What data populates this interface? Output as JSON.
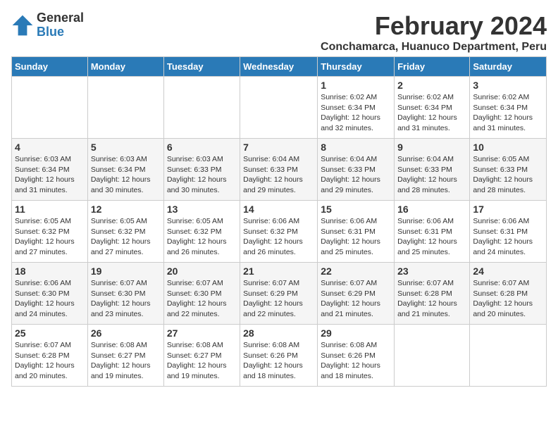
{
  "app": {
    "logo_general": "General",
    "logo_blue": "Blue",
    "title": "February 2024",
    "subtitle": "Conchamarca, Huanuco Department, Peru"
  },
  "header": {
    "days": [
      "Sunday",
      "Monday",
      "Tuesday",
      "Wednesday",
      "Thursday",
      "Friday",
      "Saturday"
    ]
  },
  "weeks": [
    {
      "cells": [
        {
          "day": "",
          "info": ""
        },
        {
          "day": "",
          "info": ""
        },
        {
          "day": "",
          "info": ""
        },
        {
          "day": "",
          "info": ""
        },
        {
          "day": "1",
          "info": "Sunrise: 6:02 AM\nSunset: 6:34 PM\nDaylight: 12 hours\nand 32 minutes."
        },
        {
          "day": "2",
          "info": "Sunrise: 6:02 AM\nSunset: 6:34 PM\nDaylight: 12 hours\nand 31 minutes."
        },
        {
          "day": "3",
          "info": "Sunrise: 6:02 AM\nSunset: 6:34 PM\nDaylight: 12 hours\nand 31 minutes."
        }
      ]
    },
    {
      "cells": [
        {
          "day": "4",
          "info": "Sunrise: 6:03 AM\nSunset: 6:34 PM\nDaylight: 12 hours\nand 31 minutes."
        },
        {
          "day": "5",
          "info": "Sunrise: 6:03 AM\nSunset: 6:34 PM\nDaylight: 12 hours\nand 30 minutes."
        },
        {
          "day": "6",
          "info": "Sunrise: 6:03 AM\nSunset: 6:33 PM\nDaylight: 12 hours\nand 30 minutes."
        },
        {
          "day": "7",
          "info": "Sunrise: 6:04 AM\nSunset: 6:33 PM\nDaylight: 12 hours\nand 29 minutes."
        },
        {
          "day": "8",
          "info": "Sunrise: 6:04 AM\nSunset: 6:33 PM\nDaylight: 12 hours\nand 29 minutes."
        },
        {
          "day": "9",
          "info": "Sunrise: 6:04 AM\nSunset: 6:33 PM\nDaylight: 12 hours\nand 28 minutes."
        },
        {
          "day": "10",
          "info": "Sunrise: 6:05 AM\nSunset: 6:33 PM\nDaylight: 12 hours\nand 28 minutes."
        }
      ]
    },
    {
      "cells": [
        {
          "day": "11",
          "info": "Sunrise: 6:05 AM\nSunset: 6:32 PM\nDaylight: 12 hours\nand 27 minutes."
        },
        {
          "day": "12",
          "info": "Sunrise: 6:05 AM\nSunset: 6:32 PM\nDaylight: 12 hours\nand 27 minutes."
        },
        {
          "day": "13",
          "info": "Sunrise: 6:05 AM\nSunset: 6:32 PM\nDaylight: 12 hours\nand 26 minutes."
        },
        {
          "day": "14",
          "info": "Sunrise: 6:06 AM\nSunset: 6:32 PM\nDaylight: 12 hours\nand 26 minutes."
        },
        {
          "day": "15",
          "info": "Sunrise: 6:06 AM\nSunset: 6:31 PM\nDaylight: 12 hours\nand 25 minutes."
        },
        {
          "day": "16",
          "info": "Sunrise: 6:06 AM\nSunset: 6:31 PM\nDaylight: 12 hours\nand 25 minutes."
        },
        {
          "day": "17",
          "info": "Sunrise: 6:06 AM\nSunset: 6:31 PM\nDaylight: 12 hours\nand 24 minutes."
        }
      ]
    },
    {
      "cells": [
        {
          "day": "18",
          "info": "Sunrise: 6:06 AM\nSunset: 6:30 PM\nDaylight: 12 hours\nand 24 minutes."
        },
        {
          "day": "19",
          "info": "Sunrise: 6:07 AM\nSunset: 6:30 PM\nDaylight: 12 hours\nand 23 minutes."
        },
        {
          "day": "20",
          "info": "Sunrise: 6:07 AM\nSunset: 6:30 PM\nDaylight: 12 hours\nand 22 minutes."
        },
        {
          "day": "21",
          "info": "Sunrise: 6:07 AM\nSunset: 6:29 PM\nDaylight: 12 hours\nand 22 minutes."
        },
        {
          "day": "22",
          "info": "Sunrise: 6:07 AM\nSunset: 6:29 PM\nDaylight: 12 hours\nand 21 minutes."
        },
        {
          "day": "23",
          "info": "Sunrise: 6:07 AM\nSunset: 6:28 PM\nDaylight: 12 hours\nand 21 minutes."
        },
        {
          "day": "24",
          "info": "Sunrise: 6:07 AM\nSunset: 6:28 PM\nDaylight: 12 hours\nand 20 minutes."
        }
      ]
    },
    {
      "cells": [
        {
          "day": "25",
          "info": "Sunrise: 6:07 AM\nSunset: 6:28 PM\nDaylight: 12 hours\nand 20 minutes."
        },
        {
          "day": "26",
          "info": "Sunrise: 6:08 AM\nSunset: 6:27 PM\nDaylight: 12 hours\nand 19 minutes."
        },
        {
          "day": "27",
          "info": "Sunrise: 6:08 AM\nSunset: 6:27 PM\nDaylight: 12 hours\nand 19 minutes."
        },
        {
          "day": "28",
          "info": "Sunrise: 6:08 AM\nSunset: 6:26 PM\nDaylight: 12 hours\nand 18 minutes."
        },
        {
          "day": "29",
          "info": "Sunrise: 6:08 AM\nSunset: 6:26 PM\nDaylight: 12 hours\nand 18 minutes."
        },
        {
          "day": "",
          "info": ""
        },
        {
          "day": "",
          "info": ""
        }
      ]
    }
  ]
}
